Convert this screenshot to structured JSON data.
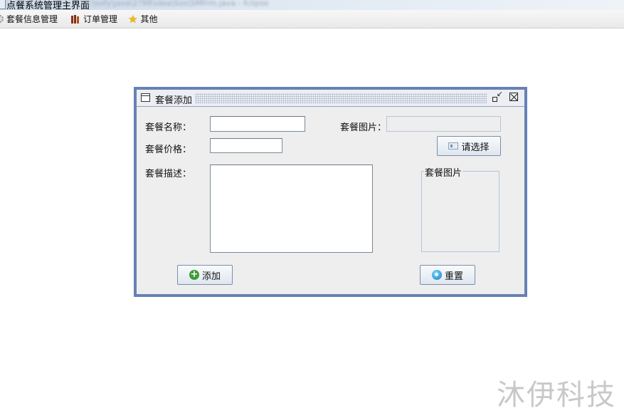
{
  "window": {
    "title": "点餐系统管理主界面",
    "path_blurred": "c:\\sofy\\java\\2?98\\idea\\Sos\\SMFrm.java - fclipse"
  },
  "menubar": {
    "items": [
      {
        "label": "套餐信息管理",
        "icon": "gear-icon"
      },
      {
        "label": "订单管理",
        "icon": "books-icon"
      },
      {
        "label": "其他",
        "icon": "star-icon"
      }
    ]
  },
  "frame": {
    "title": "套餐添加",
    "name_label": "套餐名称：",
    "name_value": "",
    "price_label": "套餐价格：",
    "price_value": "",
    "desc_label": "套餐描述：",
    "desc_value": "",
    "image_label": "套餐图片：",
    "image_value": "",
    "choose_button": "请选择",
    "image_group_label": "套餐图片",
    "add_button": "添加",
    "reset_button": "重置"
  },
  "watermark": "沐伊科技",
  "colors": {
    "frame_border": "#6781b5",
    "panel_bg": "#eeeeee"
  }
}
